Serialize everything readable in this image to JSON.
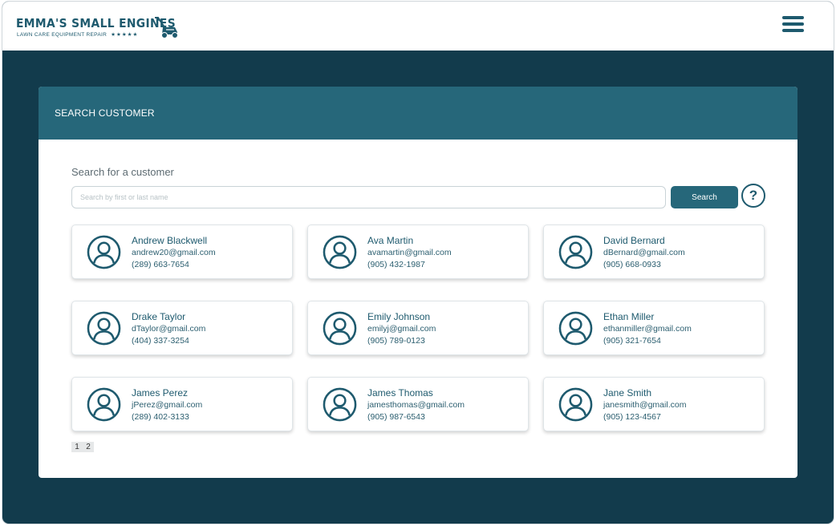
{
  "brand": {
    "title": "EMMA'S SMALL ENGINES",
    "subtitle": "LAWN CARE EQUIPMENT REPAIR",
    "stars": "★★★★★",
    "logo_icon": "lawn-mower-icon",
    "color": "#1e5a6e"
  },
  "header": {
    "menu_icon": "hamburger-menu-icon"
  },
  "panel": {
    "title": "SEARCH CUSTOMER",
    "search_label": "Search for a customer",
    "search_placeholder": "Search by first or last name",
    "search_value": "",
    "search_button": "Search",
    "help_label": "?"
  },
  "customers": [
    {
      "name": "Andrew Blackwell",
      "email": "andrew20@gmail.com",
      "phone": "(289) 663-7654"
    },
    {
      "name": "Ava Martin",
      "email": "avamartin@gmail.com",
      "phone": "(905) 432-1987"
    },
    {
      "name": "David Bernard",
      "email": "dBernard@gmail.com",
      "phone": "(905) 668-0933"
    },
    {
      "name": "Drake Taylor",
      "email": "dTaylor@gmail.com",
      "phone": "(404) 337-3254"
    },
    {
      "name": "Emily Johnson",
      "email": "emilyj@gmail.com",
      "phone": "(905) 789-0123"
    },
    {
      "name": "Ethan Miller",
      "email": "ethanmiller@gmail.com",
      "phone": "(905) 321-7654"
    },
    {
      "name": "James Perez",
      "email": "jPerez@gmail.com",
      "phone": "(289) 402-3133"
    },
    {
      "name": "James Thomas",
      "email": "jamesthomas@gmail.com",
      "phone": "(905) 987-6543"
    },
    {
      "name": "Jane Smith",
      "email": "janesmith@gmail.com",
      "phone": "(905) 123-4567"
    }
  ],
  "pagination": {
    "pages": [
      "1",
      "2"
    ]
  },
  "colors": {
    "background": "#123b4c",
    "accent": "#26677a",
    "text_primary": "#1e5a6e"
  }
}
